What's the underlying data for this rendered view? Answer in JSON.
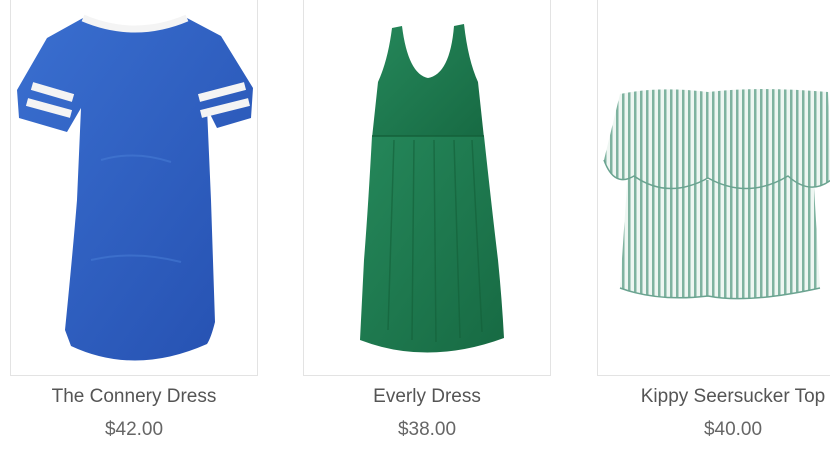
{
  "products": [
    {
      "name": "The Connery Dress",
      "price": "$42.00",
      "image_icon": "blue-tshirt-dress-image",
      "color": "#2f62c4"
    },
    {
      "name": "Everly Dress",
      "price": "$38.00",
      "image_icon": "green-tank-dress-image",
      "color": "#1f7a4f"
    },
    {
      "name": "Kippy Seersucker Top",
      "price": "$40.00",
      "image_icon": "striped-off-shoulder-top-image",
      "color": "#9cc4b4"
    }
  ]
}
